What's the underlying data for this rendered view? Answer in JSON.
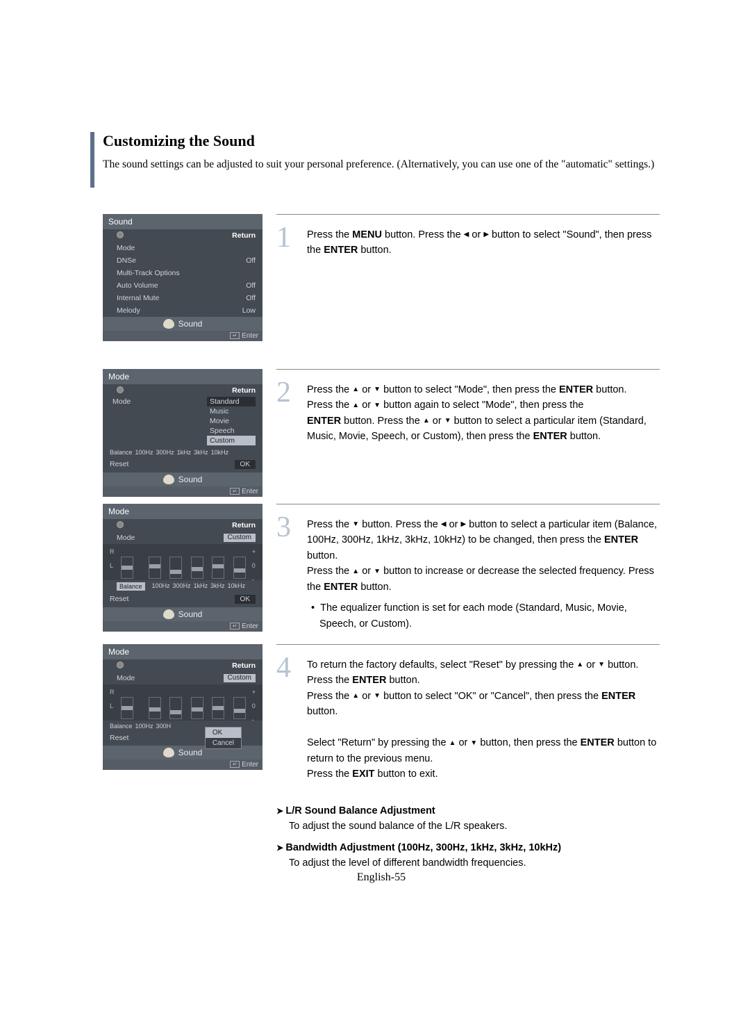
{
  "title": "Customizing the Sound",
  "subtitle": "The sound settings can be adjusted to suit your personal preference. (Alternatively, you can use one of the \"automatic\" settings.)",
  "osd1": {
    "title": "Sound",
    "return": "Return",
    "rows": [
      {
        "label": "Mode",
        "value": ""
      },
      {
        "label": "DNSe",
        "value": "Off"
      },
      {
        "label": "Multi-Track Options",
        "value": ""
      },
      {
        "label": "Auto Volume",
        "value": "Off"
      },
      {
        "label": "Internal Mute",
        "value": "Off"
      },
      {
        "label": "Melody",
        "value": "Low"
      }
    ],
    "footer": "Sound",
    "hint": "Enter"
  },
  "osd2": {
    "title": "Mode",
    "return": "Return",
    "mode": "Mode",
    "options": [
      "Standard",
      "Music",
      "Movie",
      "Speech",
      "Custom"
    ],
    "bands": [
      "Balance",
      "100Hz",
      "300Hz",
      "1kHz",
      "3kHz",
      "10kHz"
    ],
    "reset": "Reset",
    "ok": "OK",
    "footer": "Sound",
    "hint": "Enter"
  },
  "osd3": {
    "title": "Mode",
    "return": "Return",
    "mode": "Mode",
    "mode_value": "Custom",
    "bands": [
      "Balance",
      "100Hz",
      "300Hz",
      "1kHz",
      "3kHz",
      "10kHz"
    ],
    "reset": "Reset",
    "ok": "OK",
    "footer": "Sound",
    "hint": "Enter"
  },
  "osd4": {
    "title": "Mode",
    "return": "Return",
    "mode": "Mode",
    "mode_value": "Custom",
    "bands": [
      "Balance",
      "100Hz",
      "300H"
    ],
    "popup_ok": "OK",
    "popup_cancel": "Cancel",
    "reset": "Reset",
    "footer": "Sound",
    "hint": "Enter"
  },
  "steps": {
    "s1": {
      "num": "1",
      "p1_a": "Press the ",
      "p1_b": "MENU",
      "p1_c": " button. Press the ",
      "arrow_l": "◀",
      "p1_d": " or ",
      "arrow_r": "▶",
      "p1_e": " button to select \"Sound\", then press the ",
      "p1_f": "ENTER",
      "p1_g": " button."
    },
    "s2": {
      "num": "2",
      "l1a": "Press the ",
      "up": "▲",
      "l1b": " or ",
      "down": "▼",
      "l1c": " button to select \"Mode\", then press the ",
      "enter": "ENTER",
      "l1d": " button.",
      "l2a": "Press the ",
      "l2b": " or ",
      "l2c": " button again to select \"Mode\", then press the ",
      "l3a": "ENTER",
      "l3b": " button. Press the ",
      "l3c": " or ",
      "l3d": " button to select a particular item (Standard, Music, Movie, Speech, or Custom), then press the ",
      "l3e": "ENTER",
      "l3f": " button."
    },
    "s3": {
      "num": "3",
      "l1a": "Press the ",
      "down": "▼",
      "l1b": " button. Press the ",
      "left": "◀",
      "l1c": " or ",
      "right": "▶",
      "l1d": " button to select a particular item (Balance, 100Hz, 300Hz, 1kHz, 3kHz, 10kHz) to be changed, then press the ",
      "enter": "ENTER",
      "l1e": " button.",
      "l2a": "Press the ",
      "up": "▲",
      "l2b": " or ",
      "l2c": " button to increase or decrease the selected frequency. Press the ",
      "l2d": "ENTER",
      "l2e": " button.",
      "note_bullet": "•",
      "note": "The equalizer function is set for each mode (Standard, Music, Movie, Speech, or Custom)."
    },
    "s4": {
      "num": "4",
      "l1a": "To return the factory defaults, select \"Reset\" by pressing the ",
      "up": "▲",
      "l1b": " or ",
      "down": "▼",
      "l1c": " button. Press the ",
      "enter": "ENTER",
      "l1d": " button.",
      "l2a": "Press the ",
      "l2b": " or ",
      "l2c": " button to select \"OK\" or \"Cancel\", then press the ",
      "l2d": "ENTER",
      "l2e": " button.",
      "l3a": "Select \"Return\" by pressing the ",
      "l3b": " or ",
      "l3c": " button, then press the ",
      "l3d": "ENTER",
      "l3e": " button to return to the previous menu.",
      "l4a": "Press the ",
      "l4b": "EXIT",
      "l4c": " button to exit."
    }
  },
  "extra": {
    "h1": "L/R Sound Balance Adjustment",
    "t1": "To adjust the sound balance of the L/R speakers.",
    "h2": "Bandwidth Adjustment (100Hz, 300Hz, 1kHz, 3kHz, 10kHz)",
    "t2": "To adjust the level of different bandwidth frequencies."
  },
  "page_number": "English-55"
}
